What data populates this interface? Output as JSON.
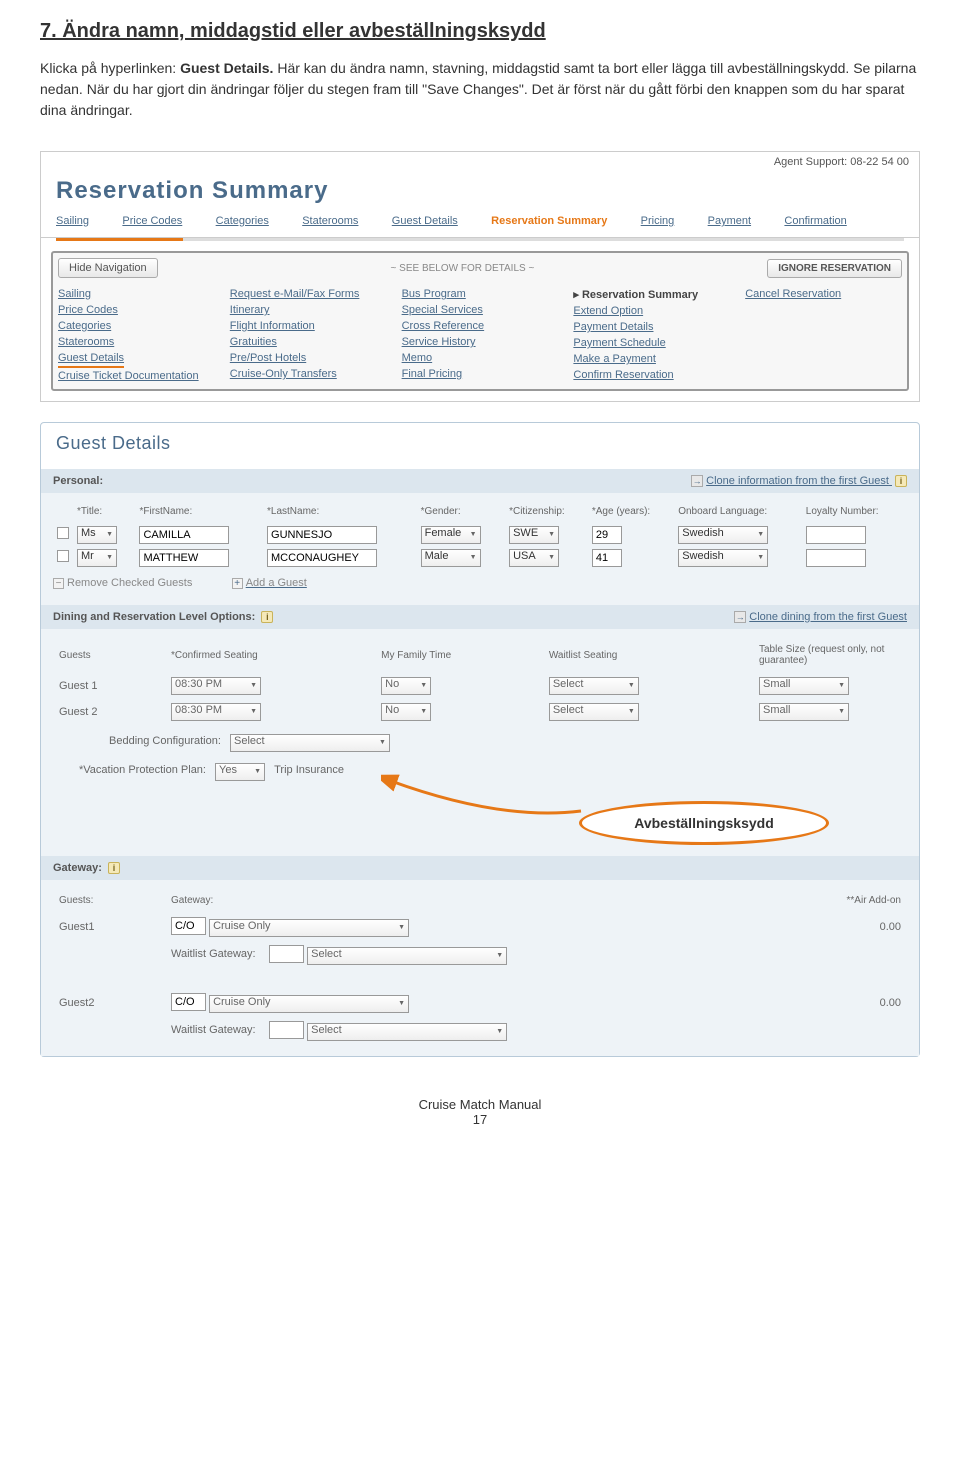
{
  "doc": {
    "heading": "7. Ändra namn, middagstid eller avbeställningsksydd",
    "para": "Klicka på hyperlinken: Guest Details. Här kan du ändra namn, stavning, middagstid samt ta bort eller lägga till avbeställningskydd. Se pilarna nedan. När du har gjort din ändringar följer du stegen fram till \"Save Changes\". Det är först när du gått förbi den knappen som du har sparat dina ändringar."
  },
  "support": "Agent Support: 08-22 54 00",
  "res_title": "Reservation Summary",
  "crumbs": [
    "Sailing",
    "Price Codes",
    "Categories",
    "Staterooms",
    "Guest Details",
    "Reservation Summary",
    "Pricing",
    "Payment",
    "Confirmation"
  ],
  "crumbs_active_index": 5,
  "nav": {
    "hide": "Hide Navigation",
    "details": "~ SEE BELOW FOR DETAILS ~",
    "ignore": "IGNORE RESERVATION",
    "cols": [
      [
        "Sailing",
        "Price Codes",
        "Categories",
        "Staterooms",
        "Guest Details",
        "Cruise Ticket Documentation"
      ],
      [
        "Request e-Mail/Fax Forms",
        "Itinerary",
        "Flight Information",
        "Gratuities",
        "Pre/Post Hotels",
        "Cruise-Only Transfers"
      ],
      [
        "Bus Program",
        "Special Services",
        "Cross Reference",
        "Service History",
        "Memo",
        "Final Pricing"
      ],
      [
        "Reservation Summary",
        "Extend Option",
        "Payment Details",
        "Payment Schedule",
        "Make a Payment",
        "Confirm Reservation"
      ],
      [
        "Cancel Reservation"
      ]
    ],
    "highlight": "Guest Details",
    "bold": "Reservation Summary"
  },
  "gd_title": "Guest Details",
  "personal": {
    "hdr": "Personal:",
    "clone": "Clone information from the first Guest",
    "cols": [
      "*Title:",
      "*FirstName:",
      "*LastName:",
      "*Gender:",
      "*Citizenship:",
      "*Age (years):",
      "Onboard Language:",
      "Loyalty Number:"
    ],
    "rows": [
      {
        "title": "Ms",
        "first": "CAMILLA",
        "last": "GUNNESJO",
        "gender": "Female",
        "cit": "SWE",
        "age": "29",
        "lang": "Swedish",
        "loyalty": ""
      },
      {
        "title": "Mr",
        "first": "MATTHEW",
        "last": "MCCONAUGHEY",
        "gender": "Male",
        "cit": "USA",
        "age": "41",
        "lang": "Swedish",
        "loyalty": ""
      }
    ],
    "remove": "Remove Checked Guests",
    "add": "Add a Guest"
  },
  "dining": {
    "hdr": "Dining and Reservation Level Options:",
    "clone": "Clone dining from the first Guest",
    "cols": [
      "Guests",
      "*Confirmed Seating",
      "My Family Time",
      "Waitlist Seating",
      "Table Size (request only, not guarantee)"
    ],
    "rows": [
      {
        "g": "Guest 1",
        "seat": "08:30 PM",
        "fam": "No",
        "wait": "Select",
        "tbl": "Small"
      },
      {
        "g": "Guest 2",
        "seat": "08:30 PM",
        "fam": "No",
        "wait": "Select",
        "tbl": "Small"
      }
    ],
    "bed_lbl": "Bedding Configuration:",
    "bed_val": "Select",
    "vac_lbl": "*Vacation Protection Plan:",
    "vac_val": "Yes",
    "trip": "Trip Insurance"
  },
  "callout": "Avbeställningsksydd",
  "gateway": {
    "hdr": "Gateway:",
    "cols": [
      "Guests:",
      "Gateway:",
      "**Air Add-on"
    ],
    "rows": [
      {
        "g": "Guest1",
        "code": "C/O",
        "gw": "Cruise Only",
        "wl_lbl": "Waitlist Gateway:",
        "wl": "Select",
        "addon": "0.00"
      },
      {
        "g": "Guest2",
        "code": "C/O",
        "gw": "Cruise Only",
        "wl_lbl": "Waitlist Gateway:",
        "wl": "Select",
        "addon": "0.00"
      }
    ]
  },
  "footer": {
    "l1": "Cruise Match Manual",
    "l2": "17"
  }
}
